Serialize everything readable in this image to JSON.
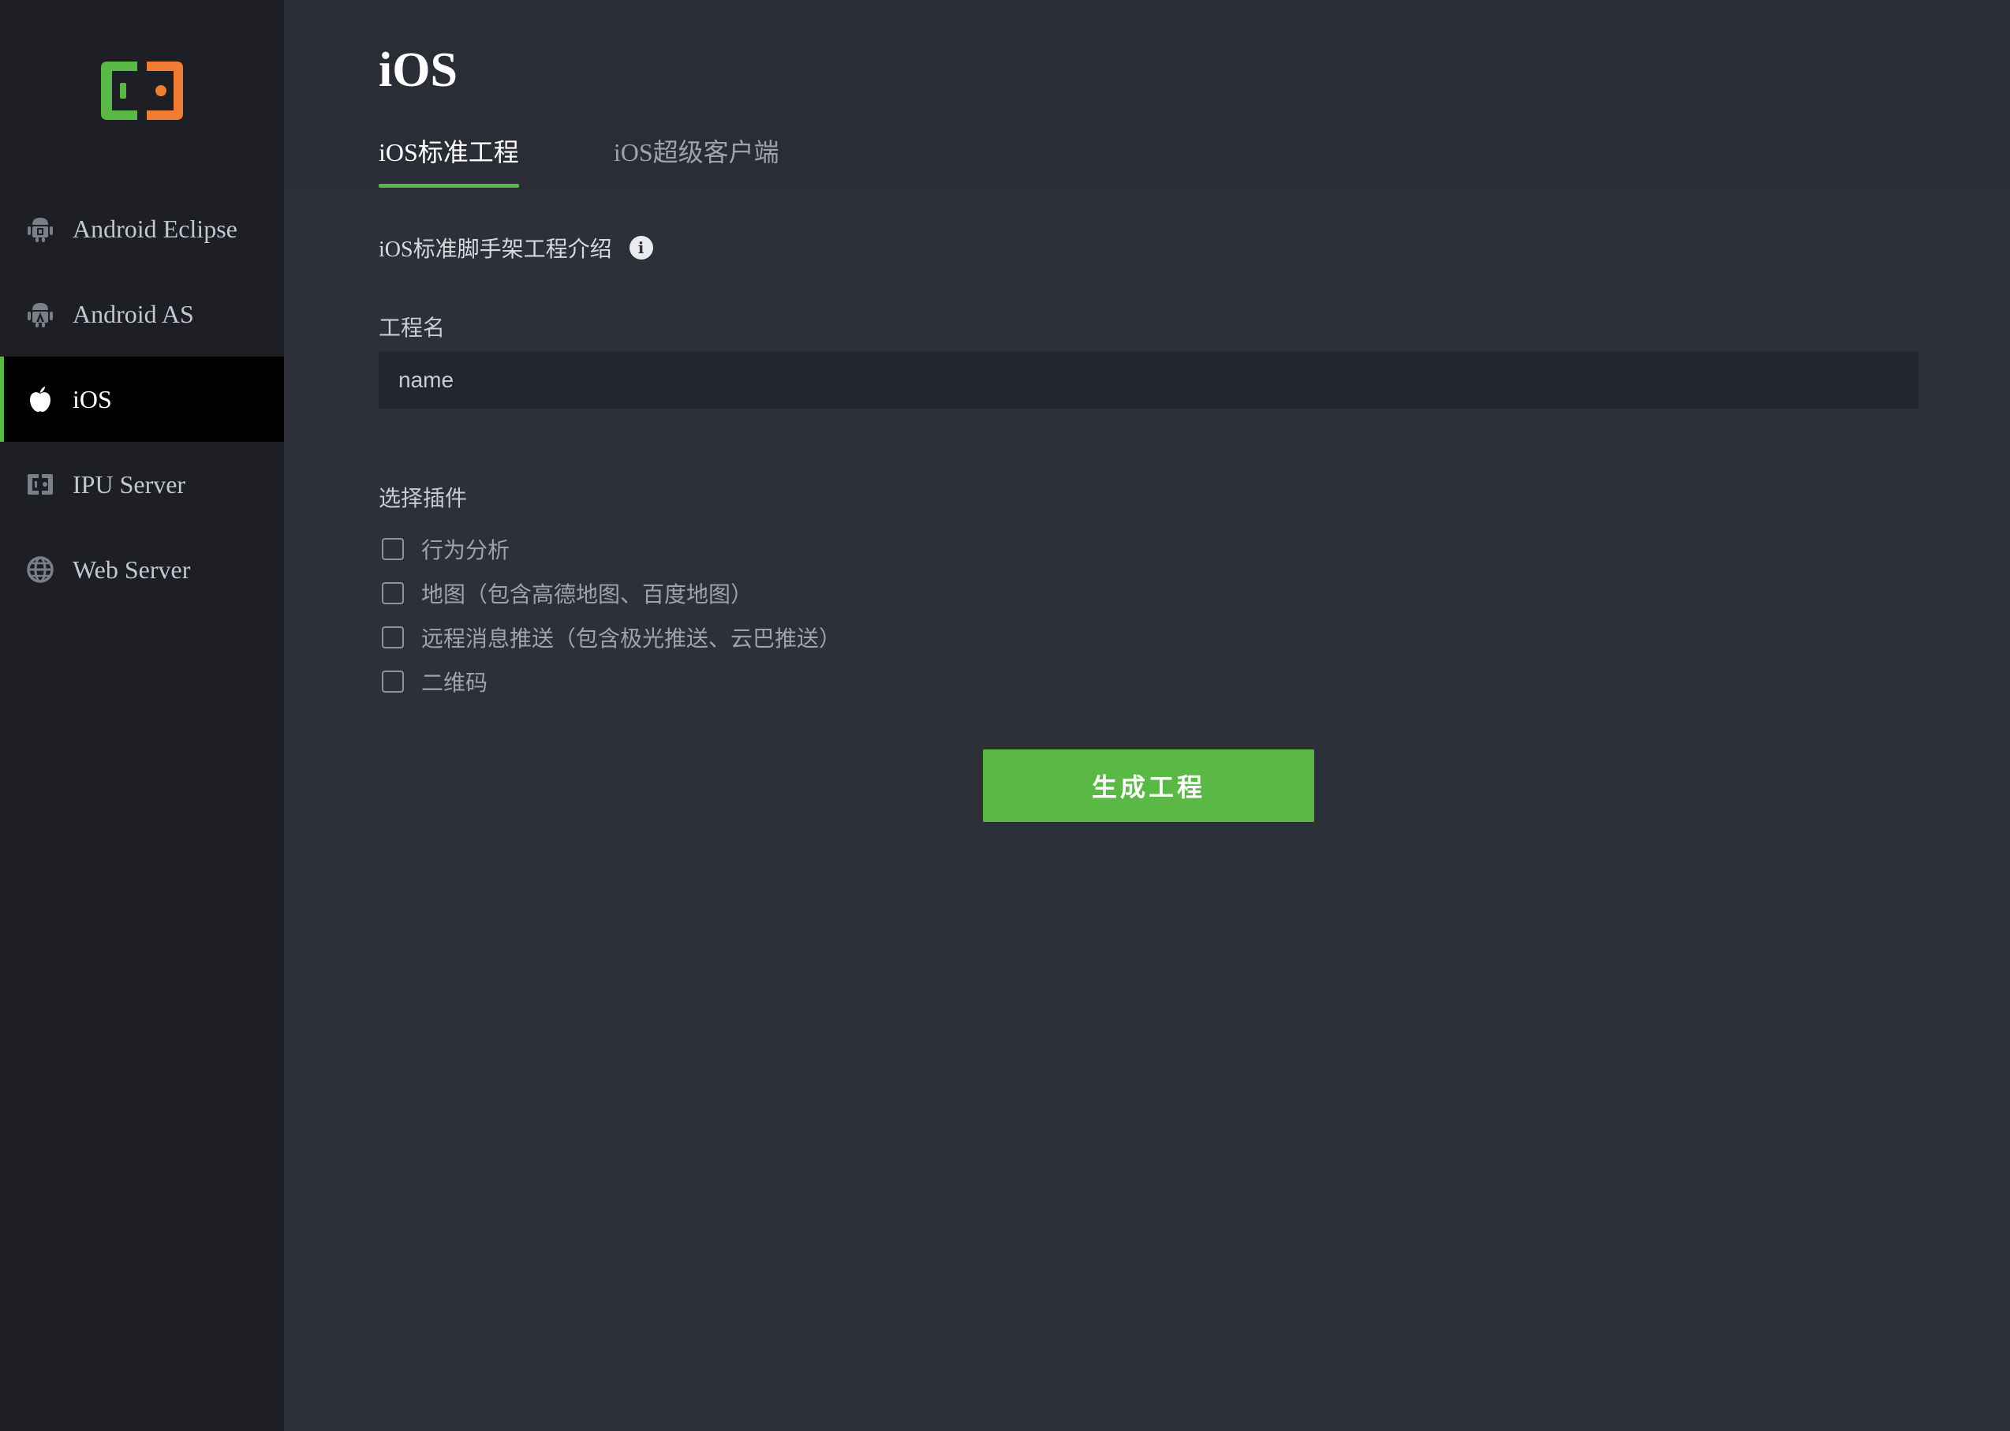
{
  "sidebar": {
    "logo_icon": "app-logo",
    "items": [
      {
        "label": "Android Eclipse",
        "icon": "android-icon",
        "active": false
      },
      {
        "label": "Android AS",
        "icon": "android-studio-icon",
        "active": false
      },
      {
        "label": "iOS",
        "icon": "apple-icon",
        "active": true
      },
      {
        "label": "IPU Server",
        "icon": "ipu-server-icon",
        "active": false
      },
      {
        "label": "Web Server",
        "icon": "globe-icon",
        "active": false
      }
    ]
  },
  "header": {
    "title": "iOS",
    "tabs": [
      {
        "label": "iOS标准工程",
        "active": true
      },
      {
        "label": "iOS超级客户端",
        "active": false
      }
    ]
  },
  "form": {
    "intro": "iOS标准脚手架工程介绍",
    "project_name_label": "工程名",
    "project_name_placeholder": "name",
    "plugins_label": "选择插件",
    "plugins": [
      {
        "label": "行为分析",
        "checked": false
      },
      {
        "label": "地图（包含高德地图、百度地图）",
        "checked": false
      },
      {
        "label": "远程消息推送（包含极光推送、云巴推送）",
        "checked": false
      },
      {
        "label": "二维码",
        "checked": false
      }
    ],
    "submit_label": "生成工程"
  },
  "colors": {
    "accent": "#59b944",
    "logo_green": "#59b944",
    "logo_orange": "#f07d32",
    "sidebar_bg": "#1e1f25",
    "main_bg": "#2d3039"
  }
}
